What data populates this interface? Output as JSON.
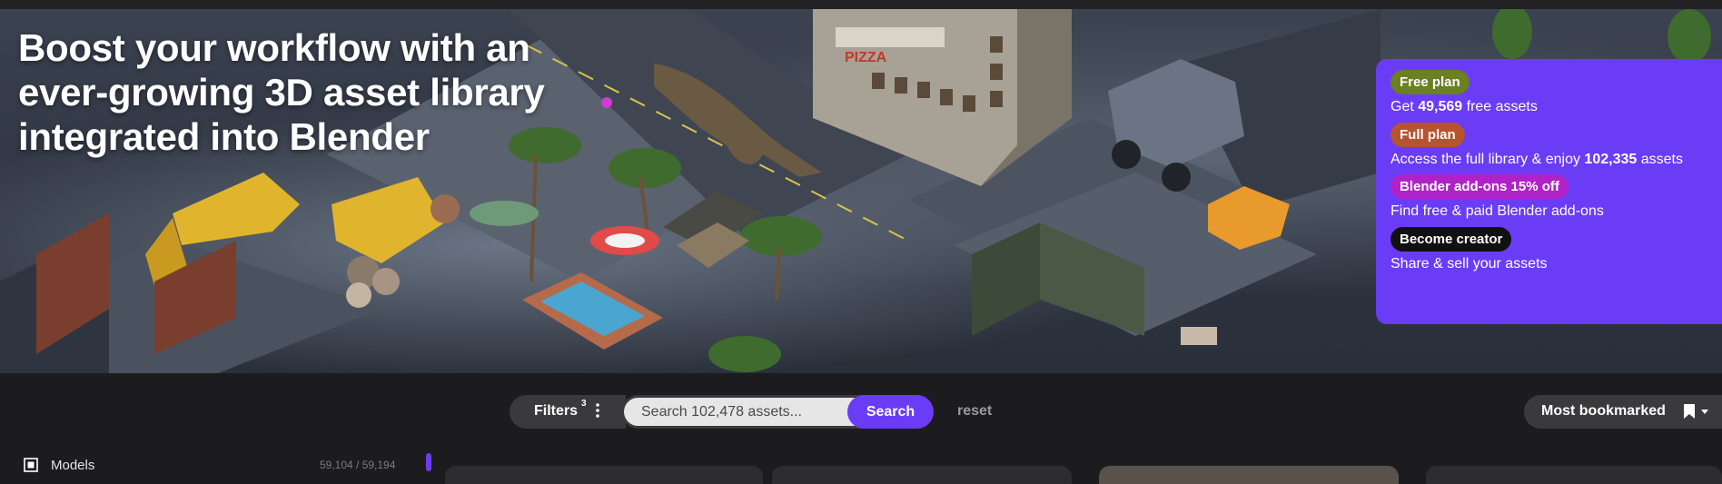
{
  "hero": {
    "title": "Boost your workflow with an ever-growing 3D asset library integrated into Blender",
    "scene_signs": {
      "pizza": "PIZZA"
    }
  },
  "plans": [
    {
      "badge": "Free plan",
      "desc_pre": "Get ",
      "desc_strong": "49,569",
      "desc_post": " free assets",
      "color": "#6b7f23"
    },
    {
      "badge": "Full plan",
      "desc_pre": "Access the full library & enjoy ",
      "desc_strong": "102,335",
      "desc_post": " assets",
      "color": "#b5542f"
    },
    {
      "badge": "Blender add-ons 15% off",
      "desc_pre": "Find free & paid Blender add-ons",
      "desc_strong": "",
      "desc_post": "",
      "color": "#b022c8"
    },
    {
      "badge": "Become creator",
      "desc_pre": "Share & sell your assets",
      "desc_strong": "",
      "desc_post": "",
      "color": "#111111"
    }
  ],
  "toolbar": {
    "filters_label": "Filters",
    "filters_count": "3",
    "search_placeholder": "Search 102,478 assets...",
    "search_button": "Search",
    "reset_label": "reset",
    "sort_label": "Most bookmarked"
  },
  "sidebar": {
    "category_label": "Models",
    "category_count": "59,104 / 59,194"
  },
  "colors": {
    "accent": "#6a3cf5",
    "free_badge": "#6b7f23",
    "full_badge": "#b5542f",
    "addons_badge": "#b022c8",
    "creator_badge": "#111111"
  },
  "icons": [
    "kebab-menu-icon",
    "bookmark-icon",
    "caret-down-icon",
    "category-models-icon"
  ]
}
